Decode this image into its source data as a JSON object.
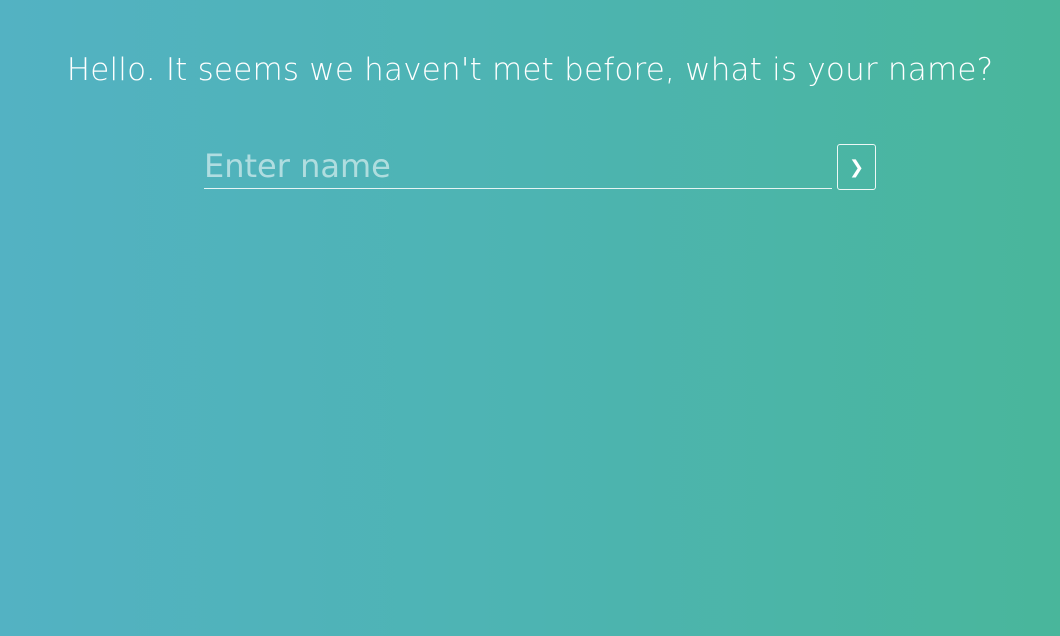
{
  "greeting": {
    "text": "Hello. It seems we haven't met before, what is your name?"
  },
  "name_form": {
    "input_placeholder": "Enter name",
    "input_value": "",
    "submit_icon": "chevron-right-icon",
    "submit_glyph": "❯"
  },
  "colors": {
    "gradient_start": "#53b2c3",
    "gradient_end": "#49b69b",
    "text": "#ffffff"
  }
}
